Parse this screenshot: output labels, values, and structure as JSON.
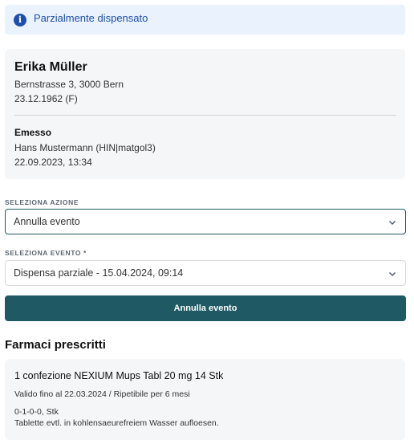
{
  "banner": {
    "icon": "info-icon",
    "text": "Parzialmente dispensato",
    "color": "#1d4fb0"
  },
  "patient": {
    "name": "Erika Müller",
    "address": "Bernstrasse 3, 3000 Bern",
    "birth": "23.12.1962 (F)",
    "issued_label": "Emesso",
    "issuer": "Hans Mustermann (HIN|matgol3)",
    "issued_date": "22.09.2023, 13:34"
  },
  "action_select": {
    "label": "SELEZIONA AZIONE",
    "value": "Annulla evento"
  },
  "event_select": {
    "label": "SELEZIONA EVENTO *",
    "value": "Dispensa parziale - 15.04.2024, 09:14"
  },
  "submit_button": {
    "label": "Annulla evento",
    "color": "#1f5963"
  },
  "medications": {
    "title": "Farmaci prescritti",
    "items": [
      {
        "name": "1 confezione NEXIUM Mups Tabl 20 mg 14 Stk",
        "validity": "Valido fino al 22.03.2024 / Ripetibile per 6 mesi",
        "dosage": "0-1-0-0, Stk",
        "note": "Tablette evtl. in kohlensaeurefreiem Wasser aufloesen."
      }
    ]
  }
}
